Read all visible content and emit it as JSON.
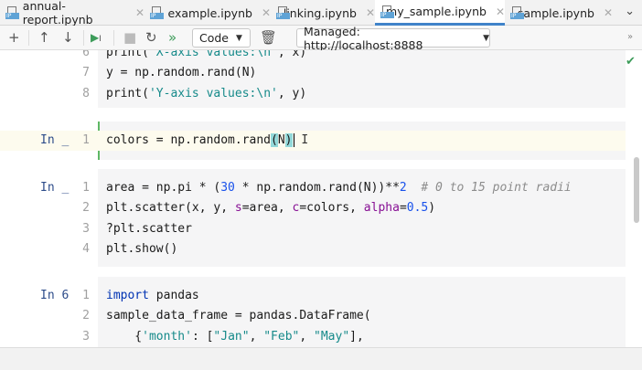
{
  "tabs": [
    {
      "label": "annual-report.ipynb",
      "icon": "notebook-icon"
    },
    {
      "label": "example.ipynb",
      "icon": "notebook-icon"
    },
    {
      "label": "linking.ipynb",
      "icon": "notebook-icon"
    },
    {
      "label": "my_sample.ipynb",
      "icon": "notebook-icon",
      "active": true
    },
    {
      "label": "sample.ipynb",
      "icon": "notebook-icon"
    }
  ],
  "toolbar": {
    "cell_type": "Code",
    "server": "Managed: http://localhost:8888",
    "add": "+",
    "up": "↑",
    "down": "↓",
    "more": "»"
  },
  "colors": {
    "accent": "#4083c9",
    "string": "#168a8a",
    "number": "#1750eb",
    "param": "#871094"
  },
  "cells": [
    {
      "prompt": "",
      "lines": [
        {
          "n": "6",
          "tokens": [
            [
              "print('",
              ""
            ],
            [
              "X-axis values:\\n",
              "s"
            ],
            [
              "', x)",
              ""
            ]
          ]
        },
        {
          "n": "7",
          "tokens": [
            [
              "y = np.random.rand(N)",
              ""
            ]
          ]
        },
        {
          "n": "8",
          "tokens": [
            [
              "print(",
              ""
            ],
            [
              "'Y-axis values:\\n'",
              "s"
            ],
            [
              ", y)",
              ""
            ]
          ]
        }
      ]
    },
    {
      "prompt": "In _",
      "lines": [
        {
          "n": "1",
          "tokens": [
            [
              "colors = np.random.rand",
              ""
            ],
            [
              "(",
              "br"
            ],
            [
              "N",
              ""
            ],
            [
              ")",
              "br"
            ]
          ]
        }
      ]
    },
    {
      "prompt": "In _",
      "lines": [
        {
          "n": "1",
          "tokens": [
            [
              "area = np.pi * (",
              ""
            ],
            [
              "30",
              "n"
            ],
            [
              " * np.random.rand(N))**",
              ""
            ],
            [
              "2",
              "n"
            ],
            [
              "  # 0 to 15 point radii",
              "c"
            ]
          ]
        },
        {
          "n": "2",
          "tokens": [
            [
              "plt.scatter(x, y, ",
              ""
            ],
            [
              "s",
              "p"
            ],
            [
              "=area, ",
              ""
            ],
            [
              "c",
              "p"
            ],
            [
              "=colors, ",
              ""
            ],
            [
              "alpha",
              "p"
            ],
            [
              "=",
              ""
            ],
            [
              "0.5",
              "n"
            ],
            [
              ")",
              ""
            ]
          ]
        },
        {
          "n": "3",
          "tokens": [
            [
              "?plt.scatter",
              ""
            ]
          ]
        },
        {
          "n": "4",
          "tokens": [
            [
              "plt.show()",
              ""
            ]
          ]
        }
      ]
    },
    {
      "prompt": "In 6",
      "lines": [
        {
          "n": "1",
          "tokens": [
            [
              "import",
              "k"
            ],
            [
              " pandas",
              ""
            ]
          ]
        },
        {
          "n": "2",
          "tokens": [
            [
              "sample_data_frame = pandas.DataFrame(",
              ""
            ]
          ]
        },
        {
          "n": "3",
          "tokens": [
            [
              "    {",
              ""
            ],
            [
              "'month'",
              "s"
            ],
            [
              ": [",
              ""
            ],
            [
              "\"Jan\"",
              "s"
            ],
            [
              ", ",
              ""
            ],
            [
              "\"Feb\"",
              "s"
            ],
            [
              ", ",
              ""
            ],
            [
              "\"May\"",
              "s"
            ],
            [
              "],",
              ""
            ]
          ]
        }
      ]
    }
  ]
}
